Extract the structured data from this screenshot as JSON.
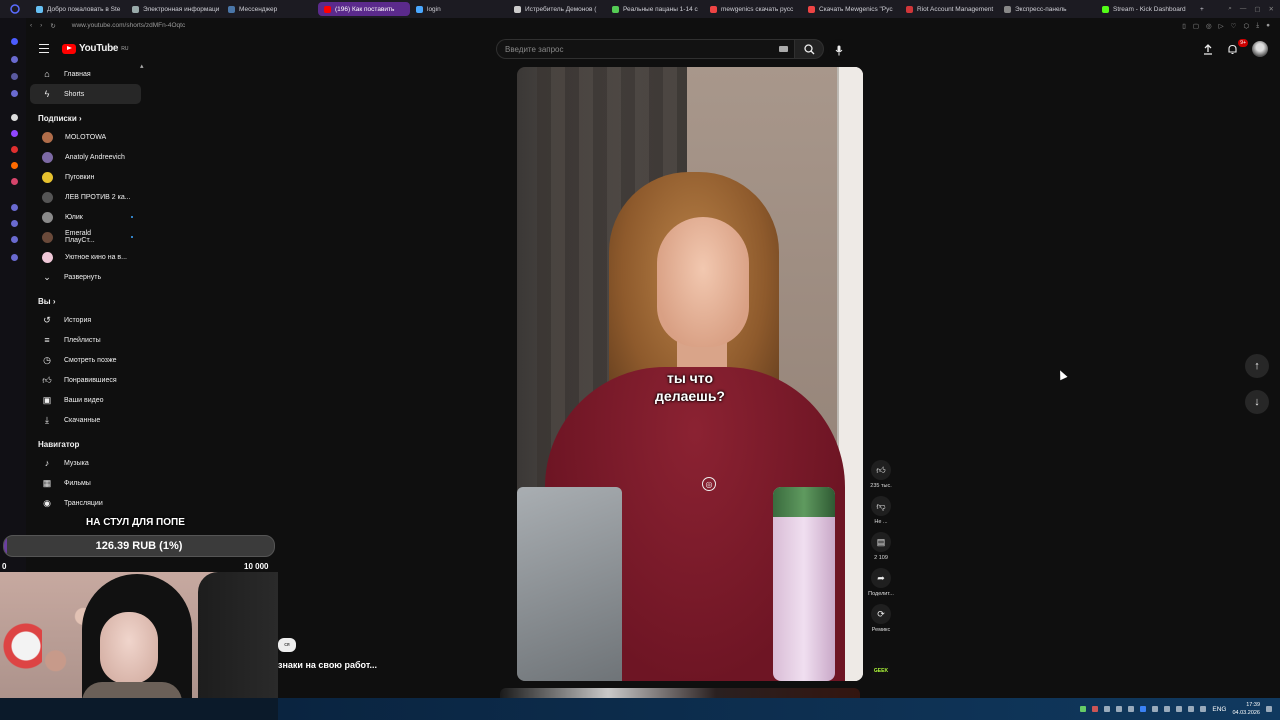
{
  "browser": {
    "tabs": [
      {
        "label": "Добро пожаловать в Ste",
        "color": "#66c0f4"
      },
      {
        "label": "Электронная информаци",
        "color": "#9aa"
      },
      {
        "label": "Мессенджер",
        "color": "#4a76a8"
      },
      {
        "label": "(196) Как поставить",
        "color": "#ff0000",
        "active": true
      },
      {
        "label": "login",
        "color": "#4aa8ff"
      },
      {
        "label": "Истребитель Демонов (",
        "color": "#ccc"
      },
      {
        "label": "Реальные пацаны 1-14 с",
        "color": "#5c5"
      },
      {
        "label": "mewgenics скачать русс",
        "color": "#e44"
      },
      {
        "label": "Скачать Mewgenics \"Рус",
        "color": "#e44"
      },
      {
        "label": "Riot Account Management",
        "color": "#d13639"
      },
      {
        "label": "Экспресс-панель",
        "color": "#888"
      },
      {
        "label": "Stream - Kick Dashboard",
        "color": "#53fc18"
      }
    ],
    "url": "www.youtube.com/shorts/zdMFn-4Oqtc"
  },
  "header": {
    "logo_text": "YouTube",
    "logo_region": "RU",
    "search_placeholder": "Введите запрос",
    "notification_badge": "9+"
  },
  "sidebar": {
    "main": [
      {
        "label": "Главная",
        "icon": "home-icon"
      },
      {
        "label": "Shorts",
        "icon": "shorts-icon",
        "active": true
      }
    ],
    "subscriptions_title": "Подписки",
    "subscriptions": [
      {
        "label": "MOLOTOWA",
        "color": "#b06d4a",
        "live": false
      },
      {
        "label": "Anatoly Andreevich",
        "color": "#7d6aa5",
        "live": false
      },
      {
        "label": "Пуговкин",
        "color": "#e6c12e",
        "live": false
      },
      {
        "label": "ЛЕВ ПРОТИВ 2 ка...",
        "color": "#555",
        "live": false
      },
      {
        "label": "Юлик",
        "color": "#8a8a8a",
        "live": true
      },
      {
        "label": "Emerald ПлауСт...",
        "color": "#6a4a3a",
        "live": true
      },
      {
        "label": "Уютное кино на в...",
        "color": "#f0c8d8",
        "live": false
      }
    ],
    "expand_label": "Развернуть",
    "you_title": "Вы",
    "you_items": [
      {
        "label": "История",
        "icon": "history-icon"
      },
      {
        "label": "Плейлисты",
        "icon": "playlists-icon"
      },
      {
        "label": "Смотреть позже",
        "icon": "watch-later-icon"
      },
      {
        "label": "Понравившиеся",
        "icon": "liked-icon"
      },
      {
        "label": "Ваши видео",
        "icon": "your-videos-icon"
      },
      {
        "label": "Скачанные",
        "icon": "downloads-icon"
      }
    ],
    "navigator_title": "Навигатор",
    "navigator_items": [
      {
        "label": "Музыка",
        "icon": "music-icon"
      },
      {
        "label": "Фильмы",
        "icon": "movies-icon"
      },
      {
        "label": "Трансляции",
        "icon": "live-icon"
      }
    ]
  },
  "video": {
    "subtitle": "ты что\nделаешь?"
  },
  "actions": {
    "likes": "235 тыс.",
    "dislike": "Не ...",
    "comments": "2 109",
    "share": "Поделит...",
    "remix": "Ремикс",
    "channel_badge": "GEEK"
  },
  "stream_overlay": {
    "caption": "НА СТУЛ ДЛЯ ПОПЕ",
    "progress_text": "126.39 RUB (1%)",
    "progress_value": 0.01,
    "range_min": "0",
    "range_max": "10 000",
    "comment_author_short": "ся",
    "comment_text": "знаки на свою работ..."
  },
  "taskbar": {
    "lang": "ENG",
    "time": "17:39",
    "date": "04.03.2026"
  }
}
